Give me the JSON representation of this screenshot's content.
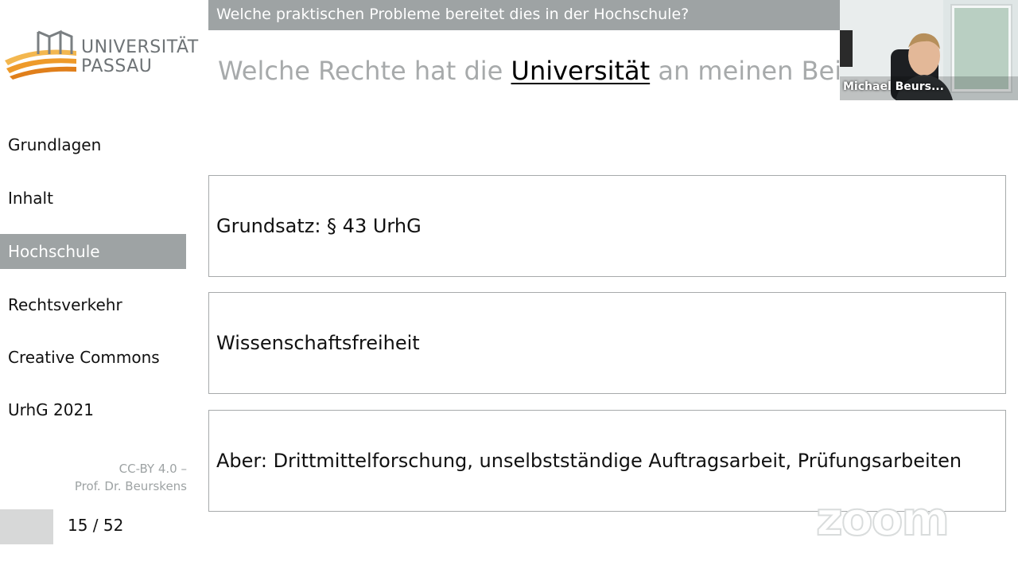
{
  "logo": {
    "line1": "UNIVERSITÄT",
    "line2": "PASSAU"
  },
  "header": {
    "question_bar": "Welche praktischen Probleme bereitet dies in der Hochschule?"
  },
  "slide": {
    "title_pre": "Welche Rechte hat die ",
    "title_em": "Universität",
    "title_post": " an meinen Beiträgen?"
  },
  "sidebar": {
    "items": [
      {
        "label": "Grundlagen",
        "active": false
      },
      {
        "label": "Inhalt",
        "active": false
      },
      {
        "label": "Hochschule",
        "active": true
      },
      {
        "label": "Rechtsverkehr",
        "active": false
      },
      {
        "label": "Creative Commons",
        "active": false
      },
      {
        "label": "UrhG 2021",
        "active": false
      }
    ]
  },
  "license": {
    "line1": "CC-BY 4.0 –",
    "line2": "Prof. Dr. Beurskens"
  },
  "pagination": {
    "text": "15 / 52"
  },
  "boxes": [
    {
      "text": "Grundsatz: § 43 UrhG"
    },
    {
      "text": "Wissenschaftsfreiheit"
    },
    {
      "text": "Aber: Drittmittelforschung, unselbstständige Auftragsarbeit, Prüfungsarbeiten"
    }
  ],
  "video": {
    "participant_name": "Michael Beurs..."
  },
  "watermark": {
    "text": "zoom"
  },
  "colors": {
    "accent_gray": "#9ea3a4",
    "logo_orange": "#f0a035",
    "title_gray": "#a7aaab"
  }
}
